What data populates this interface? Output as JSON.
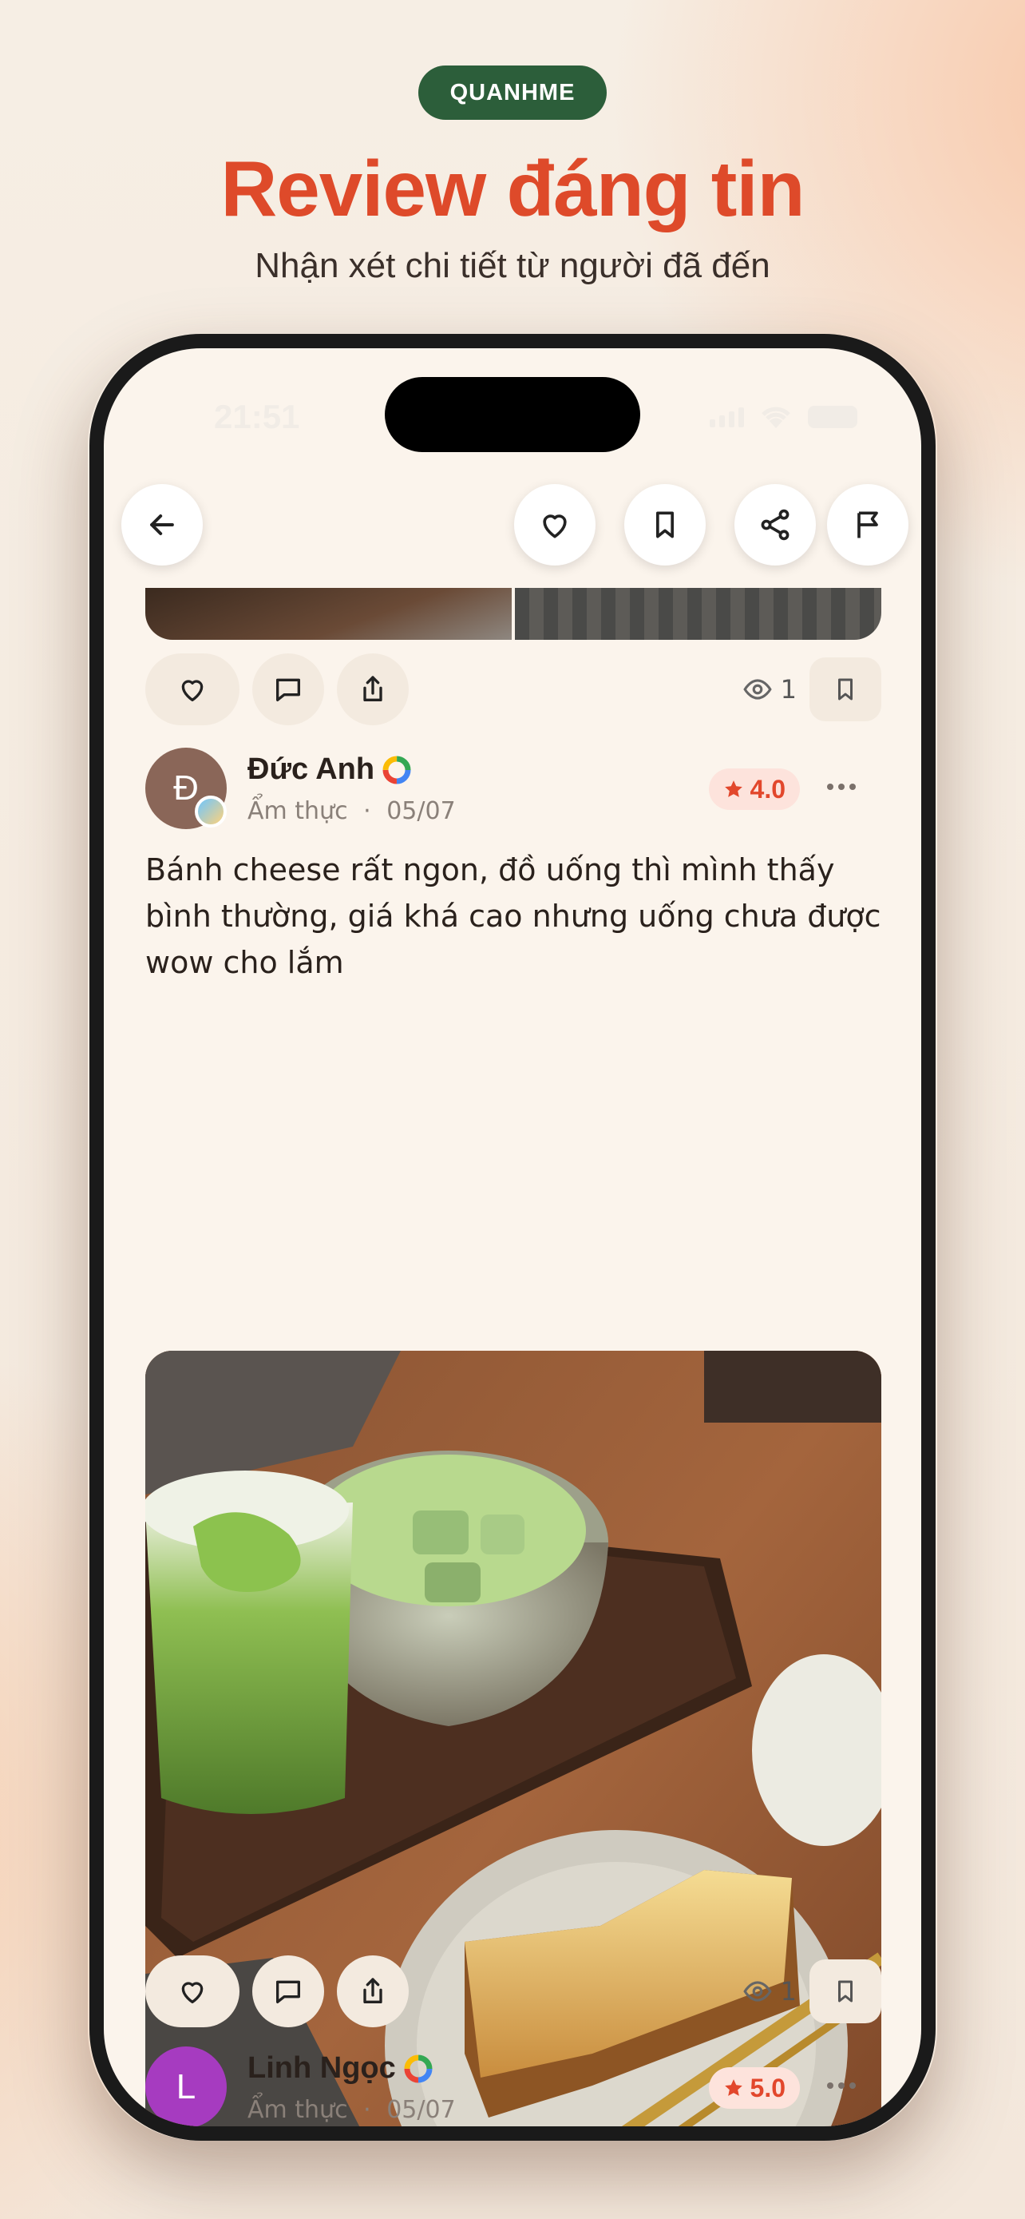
{
  "promo": {
    "badge": "QUANHME",
    "headline": "Review đáng tin",
    "subhead": "Nhận xét chi tiết từ người đã đến"
  },
  "status_bar": {
    "time": "21:51"
  },
  "top_nav": {
    "icons": [
      "back-arrow-icon",
      "heart-icon",
      "bookmark-icon",
      "share-icon",
      "flag-icon"
    ]
  },
  "reviews": [
    {
      "author": "Đức Anh",
      "avatar_letter": "Đ",
      "avatar_color": "#8a6658",
      "category": "Ẩm thực",
      "separator": "·",
      "date": "05/07",
      "rating": "4.0",
      "text": "Bánh cheese rất ngon, đồ uống thì mình thấy bình thường, giá khá cao nhưng uống chưa được wow cho lắm",
      "views": "1"
    },
    {
      "author": "Linh Ngọc",
      "avatar_letter": "L",
      "avatar_color": "#a63bc0",
      "category": "Ẩm thực",
      "separator": "·",
      "date": "05/07",
      "rating": "5.0"
    }
  ],
  "post_actions_views": "1",
  "colors": {
    "accent_red": "#de4a2a",
    "badge_green": "#2c5e3a",
    "rating_bg": "#fde3dc"
  }
}
